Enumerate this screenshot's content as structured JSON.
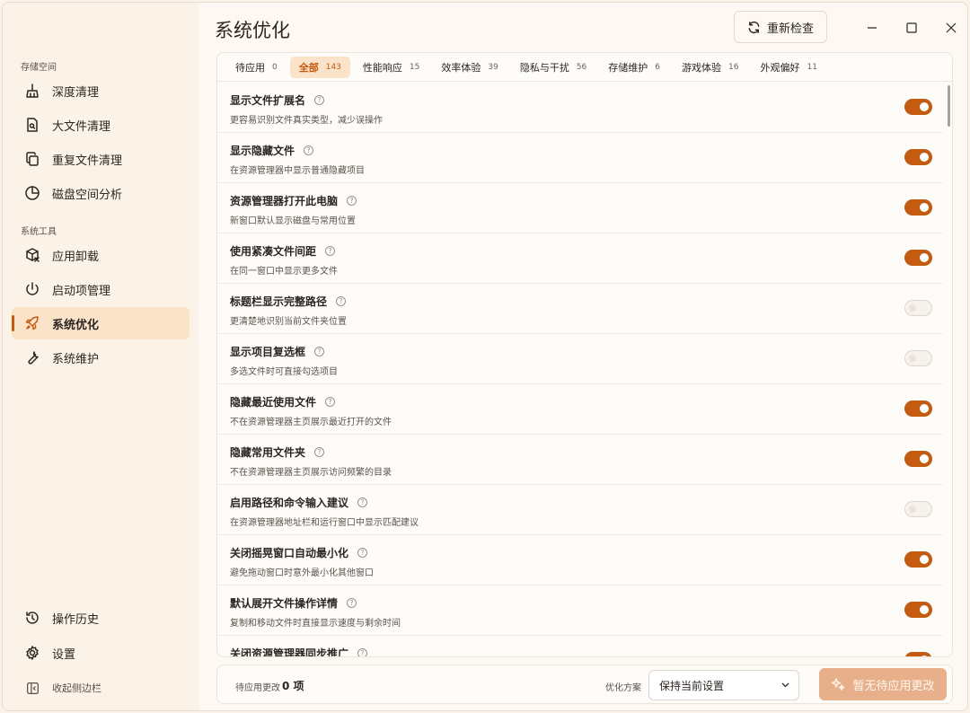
{
  "window": {
    "title": "系统优化"
  },
  "sidebar": {
    "sections": [
      "存储空间",
      "系统工具"
    ],
    "items": [
      {
        "label": "深度清理",
        "icon": "broom-icon"
      },
      {
        "label": "大文件清理",
        "icon": "file-search-icon"
      },
      {
        "label": "重复文件清理",
        "icon": "copy-icon"
      },
      {
        "label": "磁盘空间分析",
        "icon": "pie-chart-icon"
      },
      {
        "label": "应用卸载",
        "icon": "package-remove-icon"
      },
      {
        "label": "启动项管理",
        "icon": "power-icon"
      },
      {
        "label": "系统优化",
        "icon": "rocket-icon",
        "active": true
      },
      {
        "label": "系统维护",
        "icon": "wrench-icon"
      }
    ],
    "history": "操作历史",
    "settings": "设置",
    "collapse": "收起侧边栏"
  },
  "header": {
    "recheck_label": "重新检查"
  },
  "tabs": [
    {
      "label": "待应用",
      "count": "0"
    },
    {
      "label": "全部",
      "count": "143",
      "active": true
    },
    {
      "label": "性能响应",
      "count": "15"
    },
    {
      "label": "效率体验",
      "count": "39"
    },
    {
      "label": "隐私与干扰",
      "count": "56"
    },
    {
      "label": "存储维护",
      "count": "6"
    },
    {
      "label": "游戏体验",
      "count": "16"
    },
    {
      "label": "外观偏好",
      "count": "11"
    }
  ],
  "items": [
    {
      "title": "显示文件扩展名",
      "desc": "更容易识别文件真实类型，减少误操作",
      "on": true
    },
    {
      "title": "显示隐藏文件",
      "desc": "在资源管理器中显示普通隐藏项目",
      "on": true
    },
    {
      "title": "资源管理器打开此电脑",
      "desc": "新窗口默认显示磁盘与常用位置",
      "on": true
    },
    {
      "title": "使用紧凑文件间距",
      "desc": "在同一窗口中显示更多文件",
      "on": true
    },
    {
      "title": "标题栏显示完整路径",
      "desc": "更清楚地识别当前文件夹位置",
      "on": false
    },
    {
      "title": "显示项目复选框",
      "desc": "多选文件时可直接勾选项目",
      "on": false
    },
    {
      "title": "隐藏最近使用文件",
      "desc": "不在资源管理器主页展示最近打开的文件",
      "on": true
    },
    {
      "title": "隐藏常用文件夹",
      "desc": "不在资源管理器主页展示访问频繁的目录",
      "on": true
    },
    {
      "title": "启用路径和命令输入建议",
      "desc": "在资源管理器地址栏和运行窗口中显示匹配建议",
      "on": false
    },
    {
      "title": "关闭摇晃窗口自动最小化",
      "desc": "避免拖动窗口时意外最小化其他窗口",
      "on": true
    },
    {
      "title": "默认展开文件操作详情",
      "desc": "复制和移动文件时直接显示速度与剩余时间",
      "on": true
    },
    {
      "title": "关闭资源管理器同步推广",
      "desc": "",
      "on": true
    }
  ],
  "footer": {
    "pending_label": "待应用更改",
    "pending_value": "0 项",
    "plan_label": "优化方案",
    "plan_value": "保持当前设置",
    "apply_label": "暂无待应用更改"
  },
  "colors": {
    "accent": "#c35b10",
    "accent_soft": "#fbe3c9",
    "apply_disabled": "#e8b08a"
  }
}
